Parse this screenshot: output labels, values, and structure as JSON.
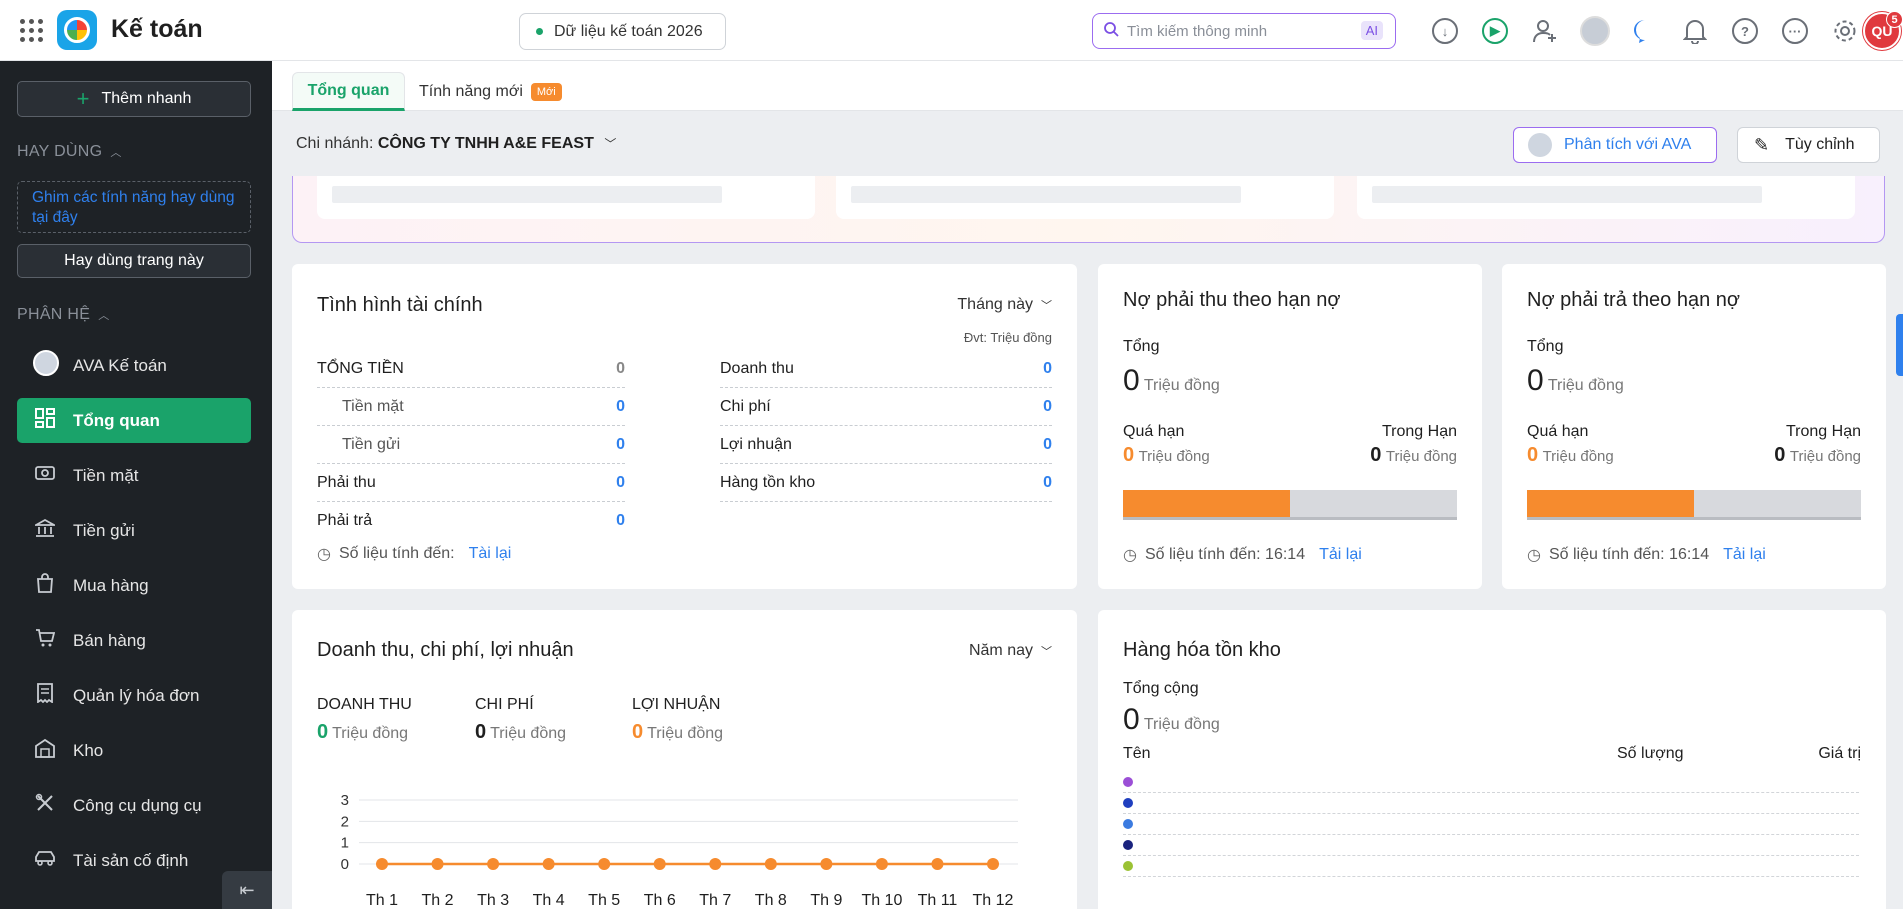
{
  "app": {
    "title": "Kế toán",
    "database": "Dữ liệu kế toán 2026"
  },
  "search": {
    "placeholder": "Tìm kiếm thông minh",
    "ai_badge": "AI"
  },
  "user": {
    "initials": "QU",
    "notifications": "5"
  },
  "sidebar": {
    "quick_add": "Thêm nhanh",
    "favorites_section": "HAY DÙNG",
    "pin_hint": "Ghim các tính năng hay dùng tại đây",
    "favorite_page": "Hay dùng trang này",
    "modules_section": "PHÂN HỆ",
    "items": [
      {
        "label": "AVA Kế toán",
        "icon": "ava-avatar-icon"
      },
      {
        "label": "Tổng quan",
        "icon": "dashboard-icon",
        "active": true
      },
      {
        "label": "Tiền mặt",
        "icon": "cash-icon"
      },
      {
        "label": "Tiền gửi",
        "icon": "bank-icon"
      },
      {
        "label": "Mua hàng",
        "icon": "shopping-bag-icon"
      },
      {
        "label": "Bán hàng",
        "icon": "cart-icon"
      },
      {
        "label": "Quản lý hóa đơn",
        "icon": "invoice-icon"
      },
      {
        "label": "Kho",
        "icon": "warehouse-icon"
      },
      {
        "label": "Công cụ dụng cụ",
        "icon": "tools-icon"
      },
      {
        "label": "Tài sản cố định",
        "icon": "car-icon"
      }
    ]
  },
  "tabs": {
    "overview": "Tổng quan",
    "new_features": "Tính năng mới",
    "new_badge": "Mới"
  },
  "branch": {
    "label": "Chi nhánh:",
    "value": "CÔNG TY TNHH A&E FEAST"
  },
  "actions": {
    "analyze": "Phân tích với AVA",
    "customize": "Tùy chỉnh"
  },
  "finance": {
    "title": "Tình hình tài chính",
    "period": "Tháng này",
    "unit_note": "Đvt: Triệu đồng",
    "left": [
      {
        "label": "TỔNG TIỀN",
        "value": "0"
      },
      {
        "label": "Tiền mặt",
        "value": "0"
      },
      {
        "label": "Tiền gửi",
        "value": "0"
      },
      {
        "label": "Phải thu",
        "value": "0"
      },
      {
        "label": "Phải trả",
        "value": "0"
      }
    ],
    "right": [
      {
        "label": "Doanh thu",
        "value": "0"
      },
      {
        "label": "Chi phí",
        "value": "0"
      },
      {
        "label": "Lợi nhuận",
        "value": "0"
      },
      {
        "label": "Hàng tồn kho",
        "value": "0"
      }
    ],
    "updated_label": "Số liệu tính đến:",
    "reload": "Tài lại"
  },
  "receivable": {
    "title": "Nợ phải thu theo hạn nợ",
    "total_label": "Tổng",
    "total_value": "0",
    "unit": "Triệu đồng",
    "overdue_label": "Quá hạn",
    "overdue_value": "0",
    "in_term_label": "Trong Hạn",
    "in_term_value": "0",
    "updated": "Số liệu tính đến: 16:14",
    "reload": "Tải lại"
  },
  "payable": {
    "title": "Nợ phải trả theo hạn nợ",
    "total_label": "Tổng",
    "total_value": "0",
    "unit": "Triệu đồng",
    "overdue_label": "Quá hạn",
    "overdue_value": "0",
    "in_term_label": "Trong Hạn",
    "in_term_value": "0",
    "updated": "Số liệu tính đến: 16:14",
    "reload": "Tải lại"
  },
  "revenue": {
    "title": "Doanh thu, chi phí, lợi nhuận",
    "period": "Năm nay",
    "unit": "Triệu đồng",
    "kpis": [
      {
        "label": "DOANH THU",
        "value": "0",
        "color": "#1aa36a"
      },
      {
        "label": "CHI PHÍ",
        "value": "0",
        "color": "#1f1f1f"
      },
      {
        "label": "LỢI NHUẬN",
        "value": "0",
        "color": "#f68b2e"
      }
    ]
  },
  "inventory": {
    "title": "Hàng hóa tồn kho",
    "total_label": "Tổng cộng",
    "total_value": "0",
    "unit": "Triệu đồng",
    "col_name": "Tên",
    "col_qty": "Số lượng",
    "col_value": "Giá trị",
    "dot_colors": [
      "#9b4fd6",
      "#1f3fbf",
      "#3b7be0",
      "#1a237e",
      "#9bc234"
    ]
  },
  "chart_data": {
    "type": "line",
    "categories": [
      "Th 1",
      "Th 2",
      "Th 3",
      "Th 4",
      "Th 5",
      "Th 6",
      "Th 7",
      "Th 8",
      "Th 9",
      "Th 10",
      "Th 11",
      "Th 12"
    ],
    "series": [
      {
        "values": [
          0,
          0,
          0,
          0,
          0,
          0,
          0,
          0,
          0,
          0,
          0,
          0
        ],
        "color": "#f68b2e"
      }
    ],
    "y_ticks": [
      "3",
      "2",
      "1",
      "0"
    ],
    "ylim": [
      0,
      3
    ],
    "grid": true
  }
}
